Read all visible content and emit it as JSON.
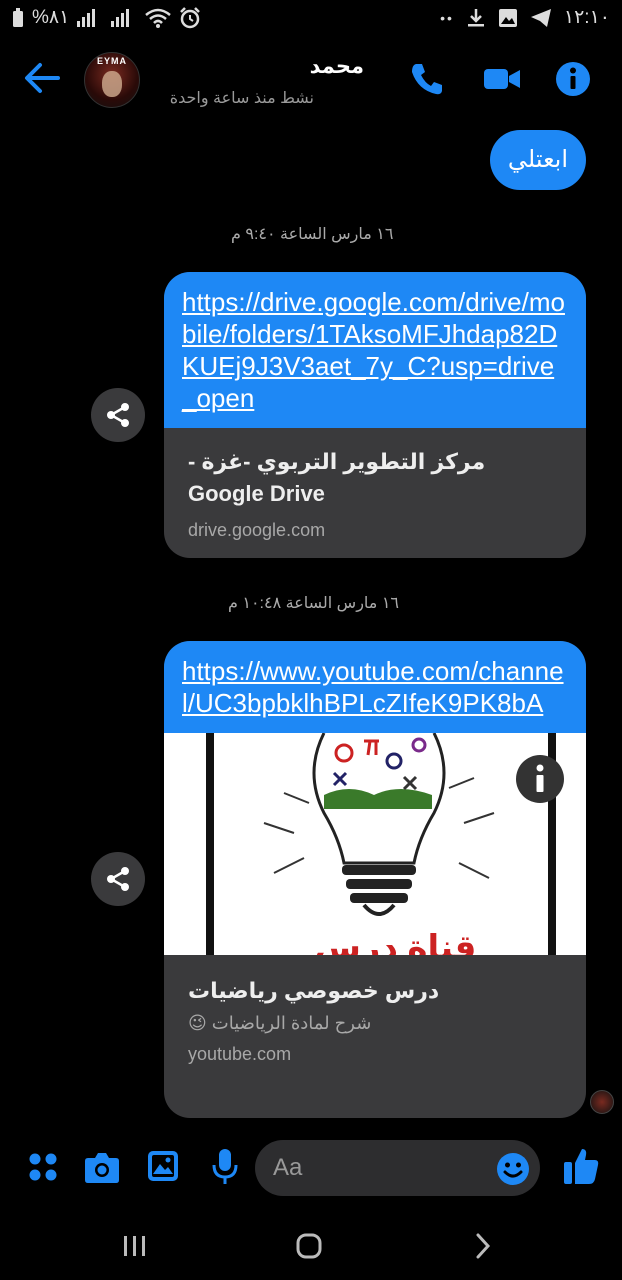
{
  "status": {
    "left_text": "%٨١",
    "time": "١٢:١٠",
    "dots": "••"
  },
  "header": {
    "contact_name": "محمد",
    "active_status": "نشط منذ ساعة واحدة",
    "avatar_text": "EYMA",
    "accent": "#1e88f5"
  },
  "messages": {
    "sent_text": "ابعتلي",
    "stamp1": "١٦ مارس الساعة ٩:٤٠ م",
    "card1": {
      "link": "https://drive.google.com/drive/mobile/folders/1TAksoMFJhdap82DKUEj9J3V3aet_7y_C?usp=drive_open",
      "title": "مركز التطوير التربوي -غزة - Google Drive",
      "domain": "drive.google.com"
    },
    "stamp2": "١٦ مارس الساعة ١٠:٤٨ م",
    "card2": {
      "link": "https://www.youtube.com/channel/UC3bpbklhBPLcZIfeK9PK8bA",
      "thumb_caption": "قناة درس",
      "title": "درس خصوصي رياضيات",
      "subtitle": "شرح لمادة الرياضيات 😉",
      "domain": "youtube.com"
    }
  },
  "composer": {
    "placeholder": "Aa"
  }
}
